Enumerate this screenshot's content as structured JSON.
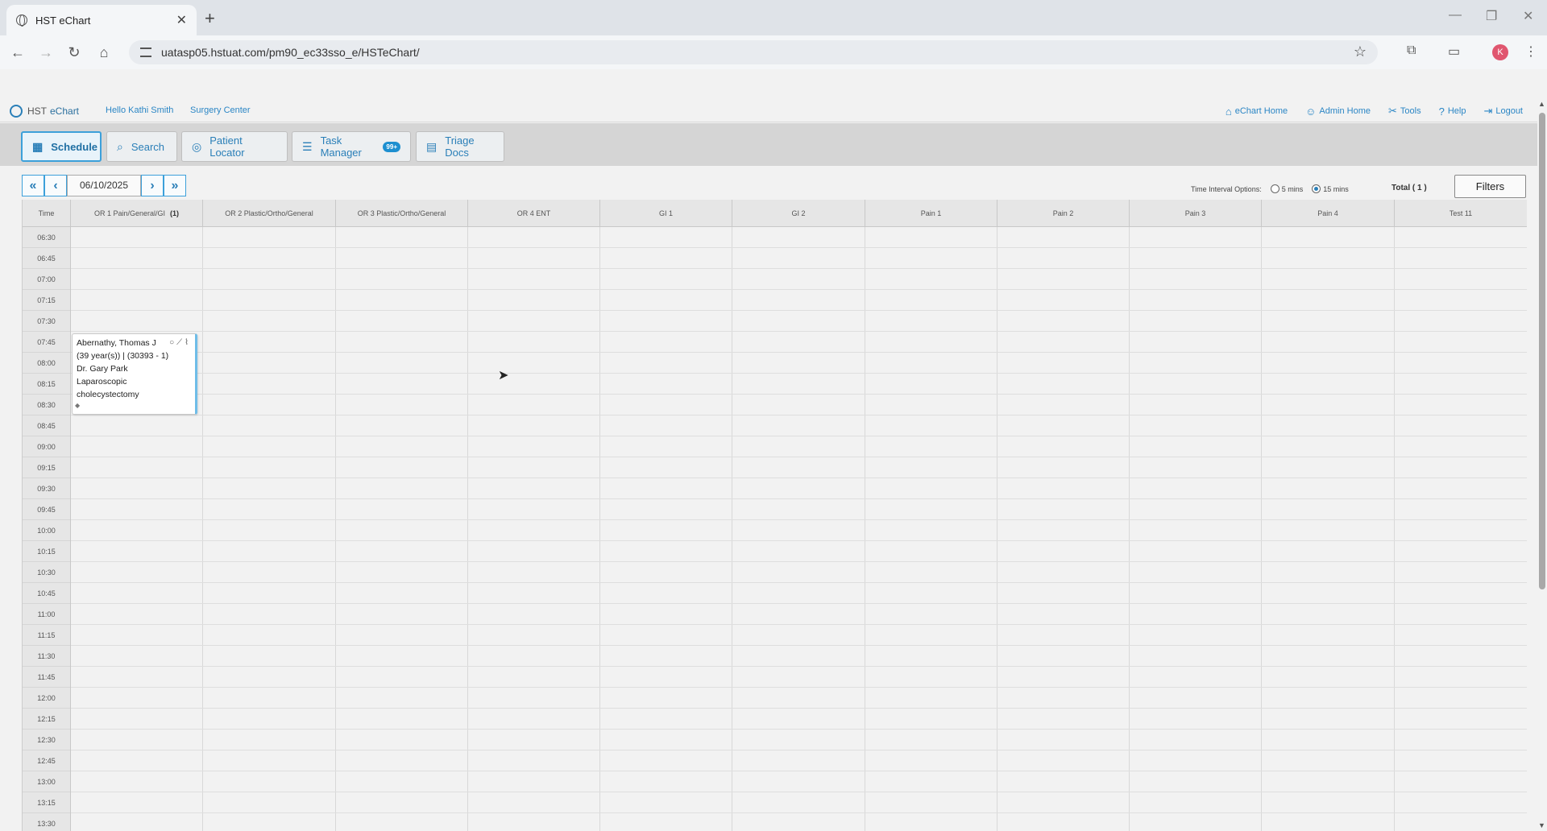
{
  "browser": {
    "tab_title": "HST eChart",
    "tab_close": "✕",
    "new_tab": "+",
    "url": "uatasp05.hstuat.com/pm90_ec33sso_e/HSTeChart/",
    "profile_initial": "K",
    "nav": {
      "back": "←",
      "forward": "→",
      "reload": "↻",
      "home": "⌂"
    },
    "window": {
      "minimize": "—",
      "restore": "❐",
      "close": "✕"
    }
  },
  "header": {
    "brand_prefix": "HST",
    "brand_name": "eChart",
    "greeting": "Hello Kathi Smith",
    "facility": "Surgery Center",
    "links": [
      {
        "label": "eChart Home",
        "icon": "house-icon"
      },
      {
        "label": "Admin Home",
        "icon": "person-icon"
      },
      {
        "label": "Tools",
        "icon": "tools-icon"
      },
      {
        "label": "Help",
        "icon": "help-icon"
      },
      {
        "label": "Logout",
        "icon": "logout-icon"
      }
    ]
  },
  "modules": [
    {
      "label": "Schedule",
      "icon": "calendar-grid-icon",
      "active": true
    },
    {
      "label": "Search",
      "icon": "search-icon"
    },
    {
      "label": "Patient Locator",
      "icon": "locator-icon"
    },
    {
      "label": "Task Manager",
      "icon": "list-icon",
      "badge": "99+"
    },
    {
      "label": "Triage Docs",
      "icon": "document-icon"
    }
  ],
  "schedule": {
    "date": "06/10/2025",
    "interval_label": "Time Interval Options:",
    "interval_options": [
      "5 mins",
      "15 mins"
    ],
    "interval_selected": "15 mins",
    "total": "Total ( 1 )",
    "filters_label": "Filters",
    "time_header": "Time",
    "columns": [
      {
        "name": "OR 1 Pain/General/GI",
        "count": "(1)"
      },
      {
        "name": "OR 2 Plastic/Ortho/General"
      },
      {
        "name": "OR 3 Plastic/Ortho/General"
      },
      {
        "name": "OR 4 ENT"
      },
      {
        "name": "GI 1"
      },
      {
        "name": "GI 2"
      },
      {
        "name": "Pain 1"
      },
      {
        "name": "Pain 2"
      },
      {
        "name": "Pain 3"
      },
      {
        "name": "Pain 4"
      },
      {
        "name": "Test 11"
      }
    ],
    "times": [
      "06:30",
      "06:45",
      "07:00",
      "07:15",
      "07:30",
      "07:45",
      "08:00",
      "08:15",
      "08:30",
      "08:45",
      "09:00",
      "09:15",
      "09:30",
      "09:45",
      "10:00",
      "10:15",
      "10:30",
      "10:45",
      "11:00",
      "11:15",
      "11:30",
      "11:45",
      "12:00",
      "12:15",
      "12:30",
      "12:45",
      "13:00",
      "13:15",
      "13:30"
    ],
    "appointment": {
      "patient": "Abernathy, Thomas J",
      "details": "(39 year(s)) | (30393 - 1)",
      "provider": "Dr. Gary Park",
      "procedure_line1": "Laparoscopic",
      "procedure_line2": "cholecystectomy",
      "start": "07:45",
      "end": "08:45"
    }
  }
}
